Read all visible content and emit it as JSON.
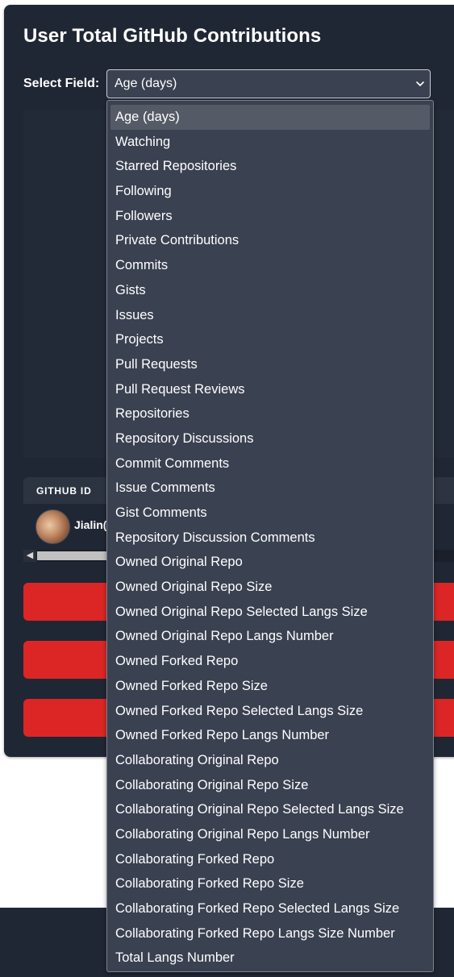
{
  "title": "User Total GitHub Contributions",
  "select": {
    "label": "Select Field:",
    "value": "Age (days)",
    "options": [
      "Age (days)",
      "Watching",
      "Starred Repositories",
      "Following",
      "Followers",
      "Private Contributions",
      "Commits",
      "Gists",
      "Issues",
      "Projects",
      "Pull Requests",
      "Pull Request Reviews",
      "Repositories",
      "Repository Discussions",
      "Commit Comments",
      "Issue Comments",
      "Gist Comments",
      "Repository Discussion Comments",
      "Owned Original Repo",
      "Owned Original Repo Size",
      "Owned Original Repo Selected Langs Size",
      "Owned Original Repo Langs Number",
      "Owned Forked Repo",
      "Owned Forked Repo Size",
      "Owned Forked Repo Selected Langs Size",
      "Owned Forked Repo Langs Number",
      "Collaborating Original Repo",
      "Collaborating Original Repo Size",
      "Collaborating Original Repo Selected Langs Size",
      "Collaborating Original Repo Langs Number",
      "Collaborating Forked Repo",
      "Collaborating Forked Repo Size",
      "Collaborating Forked Repo Selected Langs Size",
      "Collaborating Forked Repo Langs Size Number",
      "Total Langs Number"
    ]
  },
  "table": {
    "column_github_id": "GITHUB ID",
    "row": {
      "username": "Jialin("
    }
  },
  "colors": {
    "card_bg": "#202734",
    "select_bg": "#3a4151",
    "selected_option_bg": "#555b66",
    "button_red": "#dc2626"
  },
  "icons": {
    "select_chevron": "chevron-down-icon",
    "scroll_left": "chevron-left-icon"
  }
}
